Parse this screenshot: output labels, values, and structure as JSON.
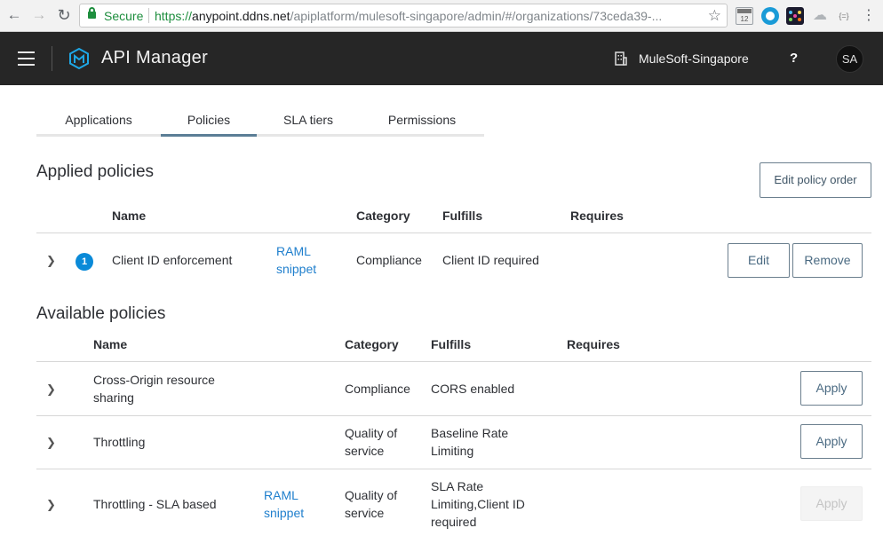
{
  "browser": {
    "secure_label": "Secure",
    "url_scheme": "https://",
    "url_host": "anypoint.ddns.net",
    "url_path": "/apiplatform/mulesoft-singapore/admin/#/organizations/73ceda39-...",
    "ext_calendar_label": "12",
    "ext_json_label": "{=}"
  },
  "header": {
    "app_title": "API Manager",
    "org_name": "MuleSoft-Singapore",
    "help": "?",
    "avatar_initials": "SA"
  },
  "tabs": [
    {
      "label": "Applications"
    },
    {
      "label": "Policies"
    },
    {
      "label": "SLA tiers"
    },
    {
      "label": "Permissions"
    }
  ],
  "active_tab": "Policies",
  "applied": {
    "title": "Applied policies",
    "edit_order_label": "Edit policy order",
    "columns": {
      "name": "Name",
      "category": "Category",
      "fulfills": "Fulfills",
      "requires": "Requires"
    },
    "rows": [
      {
        "order": "1",
        "name": "Client ID enforcement",
        "raml_line1": "RAML",
        "raml_line2": "snippet",
        "category": "Compliance",
        "fulfills": "Client ID required",
        "requires": "",
        "edit_label": "Edit",
        "remove_label": "Remove"
      }
    ]
  },
  "available": {
    "title": "Available policies",
    "columns": {
      "name": "Name",
      "category": "Category",
      "fulfills": "Fulfills",
      "requires": "Requires"
    },
    "rows": [
      {
        "name_line1": "Cross-Origin resource",
        "name_line2": "sharing",
        "category": "Compliance",
        "fulfills": "CORS enabled",
        "apply_label": "Apply"
      },
      {
        "name": "Throttling",
        "category_line1": "Quality of",
        "category_line2": "service",
        "fulfills_line1": "Baseline Rate",
        "fulfills_line2": "Limiting",
        "apply_label": "Apply"
      },
      {
        "name": "Throttling - SLA based",
        "raml_line1": "RAML",
        "raml_line2": "snippet",
        "category_line1": "Quality of",
        "category_line2": "service",
        "fulfills_line1": "SLA Rate",
        "fulfills_line2": "Limiting,Client ID",
        "fulfills_line3": "required",
        "apply_label": "Apply",
        "apply_disabled": true
      }
    ]
  },
  "colors": {
    "header_bg": "#262626",
    "link": "#1f7fcd",
    "badge": "#0a8ad8",
    "secure_green": "#1e8e3e",
    "active_tab": "#5b7e96"
  }
}
